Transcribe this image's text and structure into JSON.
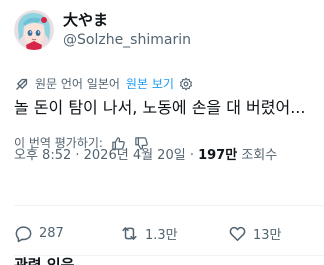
{
  "author": {
    "display_name": "大やま",
    "handle": "@Solzhe_shimarin"
  },
  "translation": {
    "notice": "원문 언어 일본어",
    "show_original": "원본 보기"
  },
  "tweet": {
    "text": "놀 돈이 탐이 나서, 노동에 손을 대 버렸어..."
  },
  "rate_translation": {
    "label": "이 번역 평가하기:"
  },
  "meta": {
    "timestamp": "오후 8:52 · 2026년 4월 20일 · ",
    "views_count": "197만",
    "views_label": " 조회수"
  },
  "actions": {
    "replies": "287",
    "retweets": "1.3만",
    "likes": "13만"
  },
  "related": {
    "label": "관련 있음"
  },
  "colors": {
    "text": "#0f1419",
    "secondary": "#536471",
    "link": "#1d9bf0",
    "divider": "#eff3f4"
  }
}
